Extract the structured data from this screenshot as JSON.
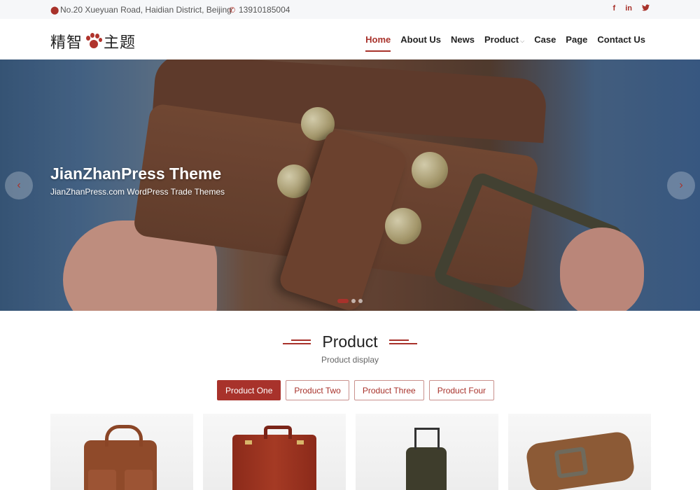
{
  "topbar": {
    "address": "No.20 Xueyuan Road, Haidian District, Beijing",
    "phone": "13910185004",
    "social": [
      "f",
      "in",
      "🐦"
    ]
  },
  "header": {
    "logo_left": "精智",
    "logo_right": "主题",
    "nav": [
      {
        "label": "Home",
        "active": true
      },
      {
        "label": "About Us"
      },
      {
        "label": "News"
      },
      {
        "label": "Product",
        "has_dropdown": true
      },
      {
        "label": "Case"
      },
      {
        "label": "Page"
      },
      {
        "label": "Contact Us"
      }
    ]
  },
  "hero": {
    "title": "JianZhanPress Theme",
    "subtitle": "JianZhanPress.com WordPress Trade Themes",
    "prev_icon": "‹",
    "next_icon": "›",
    "slide_count": 3,
    "active_slide": 1
  },
  "section": {
    "title": "Product",
    "subtitle": "Product display",
    "tabs": [
      {
        "label": "Product One",
        "active": true
      },
      {
        "label": "Product Two"
      },
      {
        "label": "Product Three"
      },
      {
        "label": "Product Four"
      }
    ],
    "products": [
      "leather-bag",
      "briefcase",
      "luggage",
      "belt"
    ]
  },
  "colors": {
    "accent": "#a8322b",
    "topbar_bg": "#f6f7f9"
  }
}
